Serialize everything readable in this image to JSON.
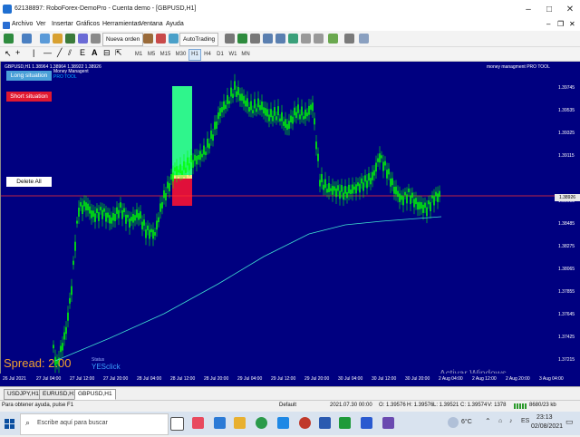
{
  "window": {
    "title": "62138897: RoboForex-DemoPro - Cuenta demo - [GBPUSD,H1]"
  },
  "menu": [
    "Archivo",
    "Ver",
    "Insertar",
    "Gráficos",
    "Herramientas",
    "Ventana",
    "Ayuda"
  ],
  "toolbar": {
    "new_order_label": "Nueva orden",
    "autotrading_label": "AutoTrading",
    "timeframes": [
      "M1",
      "M5",
      "M15",
      "M30",
      "H1",
      "H4",
      "D1",
      "W1",
      "MN"
    ],
    "active_timeframe": "H1"
  },
  "chart": {
    "symbol_line": "GBPUSD,H1  1.38964 1.38964 1.38922 1.38926",
    "indicator_title": "money managment PRO TOOL",
    "indicator_sub": "Money Managent",
    "pro_tool": "PRO  TOOL",
    "long_button": "Long situation",
    "short_button": "Short situation",
    "delete_button": "Delete All",
    "spread_label": "Spread: 2.00",
    "status_label": "Status",
    "yes_click": "YESclick",
    "current_price": "1.38926",
    "price_labels": [
      "1.39745",
      "1.39535",
      "1.39325",
      "1.39115",
      "1.38926",
      "1.38695",
      "1.38485",
      "1.38275",
      "1.38065",
      "1.37855",
      "1.37645",
      "1.37425",
      "1.37215"
    ],
    "time_labels": [
      "26 Jul 2021",
      "27 Jul 04:00",
      "27 Jul 12:00",
      "27 Jul 20:00",
      "28 Jul 04:00",
      "28 Jul 12:00",
      "28 Jul 20:00",
      "29 Jul 04:00",
      "29 Jul 12:00",
      "29 Jul 20:00",
      "30 Jul 04:00",
      "30 Jul 12:00",
      "30 Jul 20:00",
      "2 Aug 04:00",
      "2 Aug 12:00",
      "2 Aug 20:00",
      "3 Aug 04:00"
    ],
    "watermark_title": "Activar Windows",
    "watermark_sub": "Ve a Configuración para activar Windows.",
    "colors": {
      "background": "#000080",
      "candle": "#00ff00",
      "ma": "#40e0d0",
      "price_line": "#ff3030",
      "tp_zone": "#2ff58c",
      "sl_zone": "#e0103a"
    }
  },
  "tabs": [
    "USDJPY,H1",
    "EURUSD,H1",
    "GBPUSD,H1"
  ],
  "active_tab": "GBPUSD,H1",
  "status": {
    "help": "Para obtener ayuda, pulse F1",
    "profile": "Default",
    "datetime": "2021.07.30 00:00",
    "open": "O: 1.39576",
    "high": "H: 1.39576",
    "low": "L: 1.39521",
    "close": "C: 1.39574",
    "volume": "V: 1378",
    "traffic": "8680/23 kb"
  },
  "taskbar": {
    "search_placeholder": "Escribe aquí para buscar",
    "weather": "6°C",
    "time": "23:13",
    "date": "02/08/2021"
  }
}
